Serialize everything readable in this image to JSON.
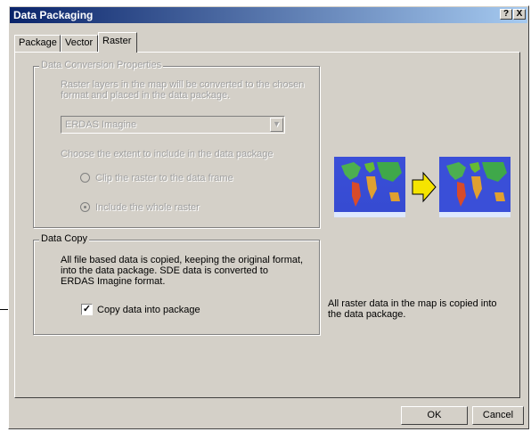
{
  "window": {
    "title": "Data Packaging",
    "help_label": "?",
    "close_label": "X"
  },
  "tabs": [
    {
      "label": "Package"
    },
    {
      "label": "Vector"
    },
    {
      "label": "Raster"
    }
  ],
  "conversion": {
    "legend": "Data Conversion Properties",
    "description_line1": "Raster layers in the map will be converted to the chosen",
    "description_line2": "format and placed in the data package.",
    "format_value": "ERDAS Imagine",
    "extent_label": "Choose the extent  to include in the data package",
    "option_clip": "Clip the raster to the data frame",
    "option_whole": "Include the whole raster"
  },
  "copy": {
    "legend": "Data Copy",
    "description_line1": "All file based data is copied, keeping the original format,",
    "description_line2": "into the data package.  SDE data is converted to",
    "description_line3": "ERDAS Imagine format.",
    "checkbox_label": "Copy data into package",
    "checked": true
  },
  "preview": {
    "caption_line1": "All raster data in the map is copied into",
    "caption_line2": "the data package.",
    "arrow_color": "#f5e400",
    "map_ocean_color": "#3a4fd8"
  },
  "buttons": {
    "ok": "OK",
    "cancel": "Cancel"
  }
}
